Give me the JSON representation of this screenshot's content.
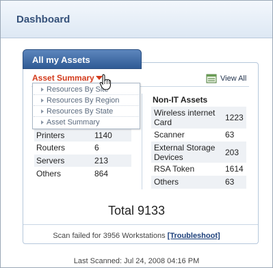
{
  "header": {
    "title": "Dashboard"
  },
  "tab": {
    "label": "All my Assets"
  },
  "summary": {
    "label": "Asset Summary"
  },
  "view_all": {
    "label": "View All",
    "icon": "view-all-icon"
  },
  "dropdown": {
    "items": [
      {
        "label": "Resources By Site"
      },
      {
        "label": "Resources By Region"
      },
      {
        "label": "Resources By State"
      },
      {
        "label": "Asset Summary"
      }
    ]
  },
  "it_assets": {
    "rows": [
      {
        "label": "Printers",
        "value": "1140"
      },
      {
        "label": "Routers",
        "value": "6"
      },
      {
        "label": "Servers",
        "value": "213"
      },
      {
        "label": "Others",
        "value": "864"
      }
    ]
  },
  "non_it_assets": {
    "title": "Non-IT Assets",
    "rows": [
      {
        "label": "Wireless internet Card",
        "value": "1223"
      },
      {
        "label": "Scanner",
        "value": "63"
      },
      {
        "label": "External Storage Devices",
        "value": "203"
      },
      {
        "label": "RSA Token",
        "value": "1614"
      },
      {
        "label": "Others",
        "value": "63"
      }
    ]
  },
  "total": {
    "text": "Total 9133"
  },
  "scan": {
    "failed_text": "Scan failed for 3956 Workstations",
    "troubleshoot_label": "[Troubleshoot]",
    "last_scanned": "Last Scanned: Jul 24, 2008 04:16 PM"
  },
  "colors": {
    "accent_red": "#d33a1b",
    "tab_blue": "#2f5b95",
    "header_text": "#35517a",
    "link_blue": "#1c3f7a"
  }
}
